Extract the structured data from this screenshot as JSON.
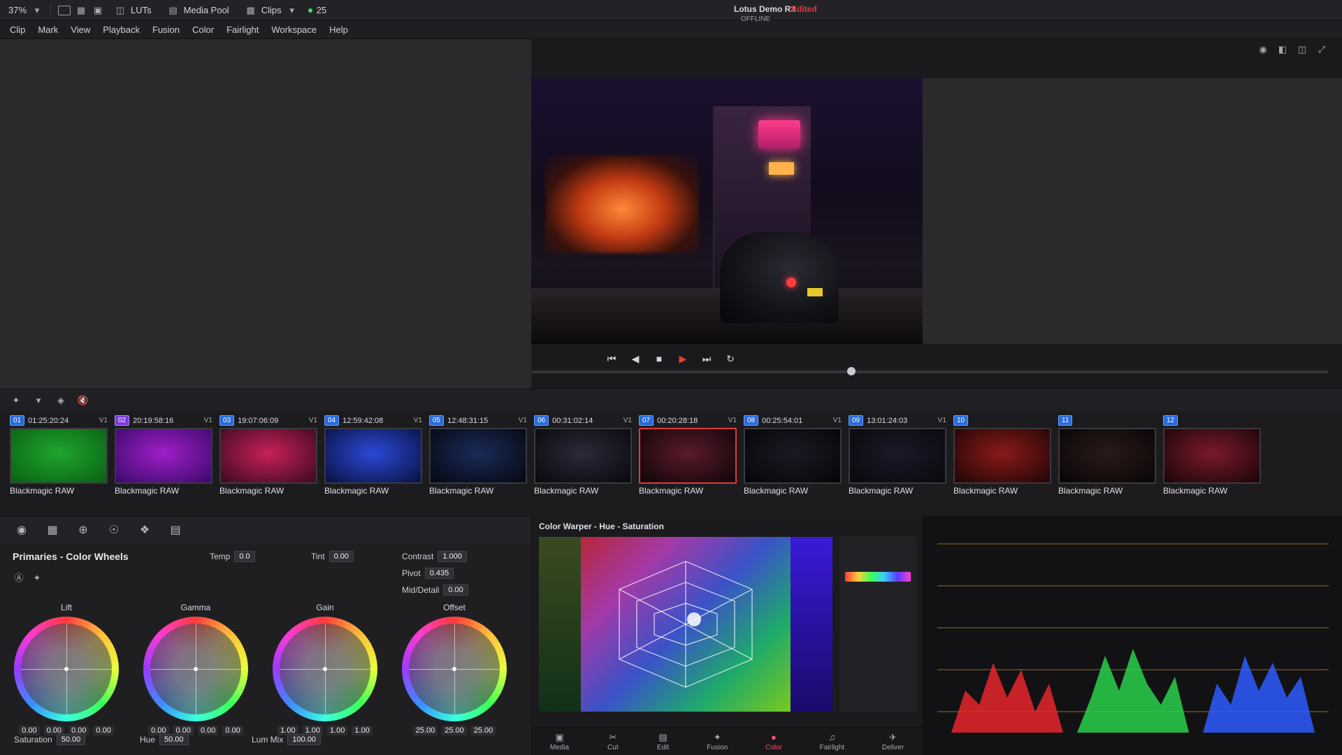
{
  "toolbar": {
    "zoom": "37%",
    "luts": "LUTs",
    "media_pool": "Media Pool",
    "clips": "Clips",
    "count": "25"
  },
  "menu": [
    "Clip",
    "Mark",
    "View",
    "Playback",
    "Fusion",
    "Color",
    "Fairlight",
    "Workspace",
    "Help"
  ],
  "viewer": {
    "project_title": "Lotus Demo R3",
    "edited": "Edited",
    "status": "OFFLINE"
  },
  "clips": [
    {
      "num": "01",
      "tc": "01:25:20:24",
      "track": "V1",
      "name": "Blackmagic RAW",
      "thumb": [
        "#1ea52e",
        "#0b6014"
      ]
    },
    {
      "num": "02",
      "tc": "20:19:58:16",
      "track": "V1",
      "name": "Blackmagic RAW",
      "thumb": [
        "#a01ec8",
        "#3a0a6a"
      ]
    },
    {
      "num": "03",
      "tc": "19:07:06:09",
      "track": "V1",
      "name": "Blackmagic RAW",
      "thumb": [
        "#c8205a",
        "#3a0a20"
      ]
    },
    {
      "num": "04",
      "tc": "12:59:42:08",
      "track": "V1",
      "name": "Blackmagic RAW",
      "thumb": [
        "#2a4ad8",
        "#0a1040"
      ]
    },
    {
      "num": "05",
      "tc": "12:48:31:15",
      "track": "V1",
      "name": "Blackmagic RAW",
      "thumb": [
        "#1a2a5a",
        "#05080f"
      ]
    },
    {
      "num": "06",
      "tc": "00:31:02:14",
      "track": "V1",
      "name": "Blackmagic RAW",
      "thumb": [
        "#2a2a3a",
        "#08080c"
      ]
    },
    {
      "num": "07",
      "tc": "00:20:28:18",
      "track": "V1",
      "name": "Blackmagic RAW",
      "thumb": [
        "#5a1a2a",
        "#0f0508"
      ]
    },
    {
      "num": "08",
      "tc": "00:25:54:01",
      "track": "V1",
      "name": "Blackmagic RAW",
      "thumb": [
        "#1a1a24",
        "#050508"
      ]
    },
    {
      "num": "09",
      "tc": "13:01:24:03",
      "track": "V1",
      "name": "Blackmagic RAW",
      "thumb": [
        "#1a1a2a",
        "#08080c"
      ]
    },
    {
      "num": "10",
      "tc": "",
      "track": "",
      "name": "Blackmagic RAW",
      "thumb": [
        "#8a1a1a",
        "#200505"
      ]
    },
    {
      "num": "11",
      "tc": "",
      "track": "",
      "name": "Blackmagic RAW",
      "thumb": [
        "#2a1a1a",
        "#080505"
      ]
    },
    {
      "num": "12",
      "tc": "",
      "track": "",
      "name": "Blackmagic RAW",
      "thumb": [
        "#7a1a2a",
        "#1a0508"
      ]
    }
  ],
  "primaries": {
    "title": "Primaries - Color Wheels",
    "temp_label": "Temp",
    "temp_value": "0.0",
    "tint_label": "Tint",
    "tint_value": "0.00",
    "contrast_label": "Contrast",
    "contrast_value": "1.000",
    "pivot_label": "Pivot",
    "pivot_value": "0.435",
    "mid_detail_label": "Mid/Detail",
    "mid_detail_value": "0.00",
    "wheels": [
      {
        "label": "Lift",
        "values": [
          "0.00",
          "0.00",
          "0.00",
          "0.00"
        ]
      },
      {
        "label": "Gamma",
        "values": [
          "0.00",
          "0.00",
          "0.00",
          "0.00"
        ]
      },
      {
        "label": "Gain",
        "values": [
          "1.00",
          "1.00",
          "1.00",
          "1.00"
        ]
      },
      {
        "label": "Offset",
        "values": [
          "25.00",
          "25.00",
          "25.00"
        ]
      }
    ],
    "saturation_label": "Saturation",
    "saturation_value": "50.00",
    "hue_label": "Hue",
    "hue_value": "50.00",
    "lum_mix_label": "Lum Mix",
    "lum_mix_value": "100.00"
  },
  "warper": {
    "title": "Color Warper - Hue - Saturation"
  },
  "pages": [
    {
      "label": "Media",
      "icon": "▣",
      "active": false
    },
    {
      "label": "Cut",
      "icon": "✂",
      "active": false
    },
    {
      "label": "Edit",
      "icon": "▤",
      "active": false
    },
    {
      "label": "Fusion",
      "icon": "✦",
      "active": false
    },
    {
      "label": "Color",
      "icon": "●",
      "active": true
    },
    {
      "label": "Fairlight",
      "icon": "♫",
      "active": false
    },
    {
      "label": "Deliver",
      "icon": "✈",
      "active": false
    }
  ],
  "colors": {
    "accent_red": "#e03b3b",
    "clip_blue": "#2a6bd8",
    "clip_selected": "#7a3bd8"
  }
}
